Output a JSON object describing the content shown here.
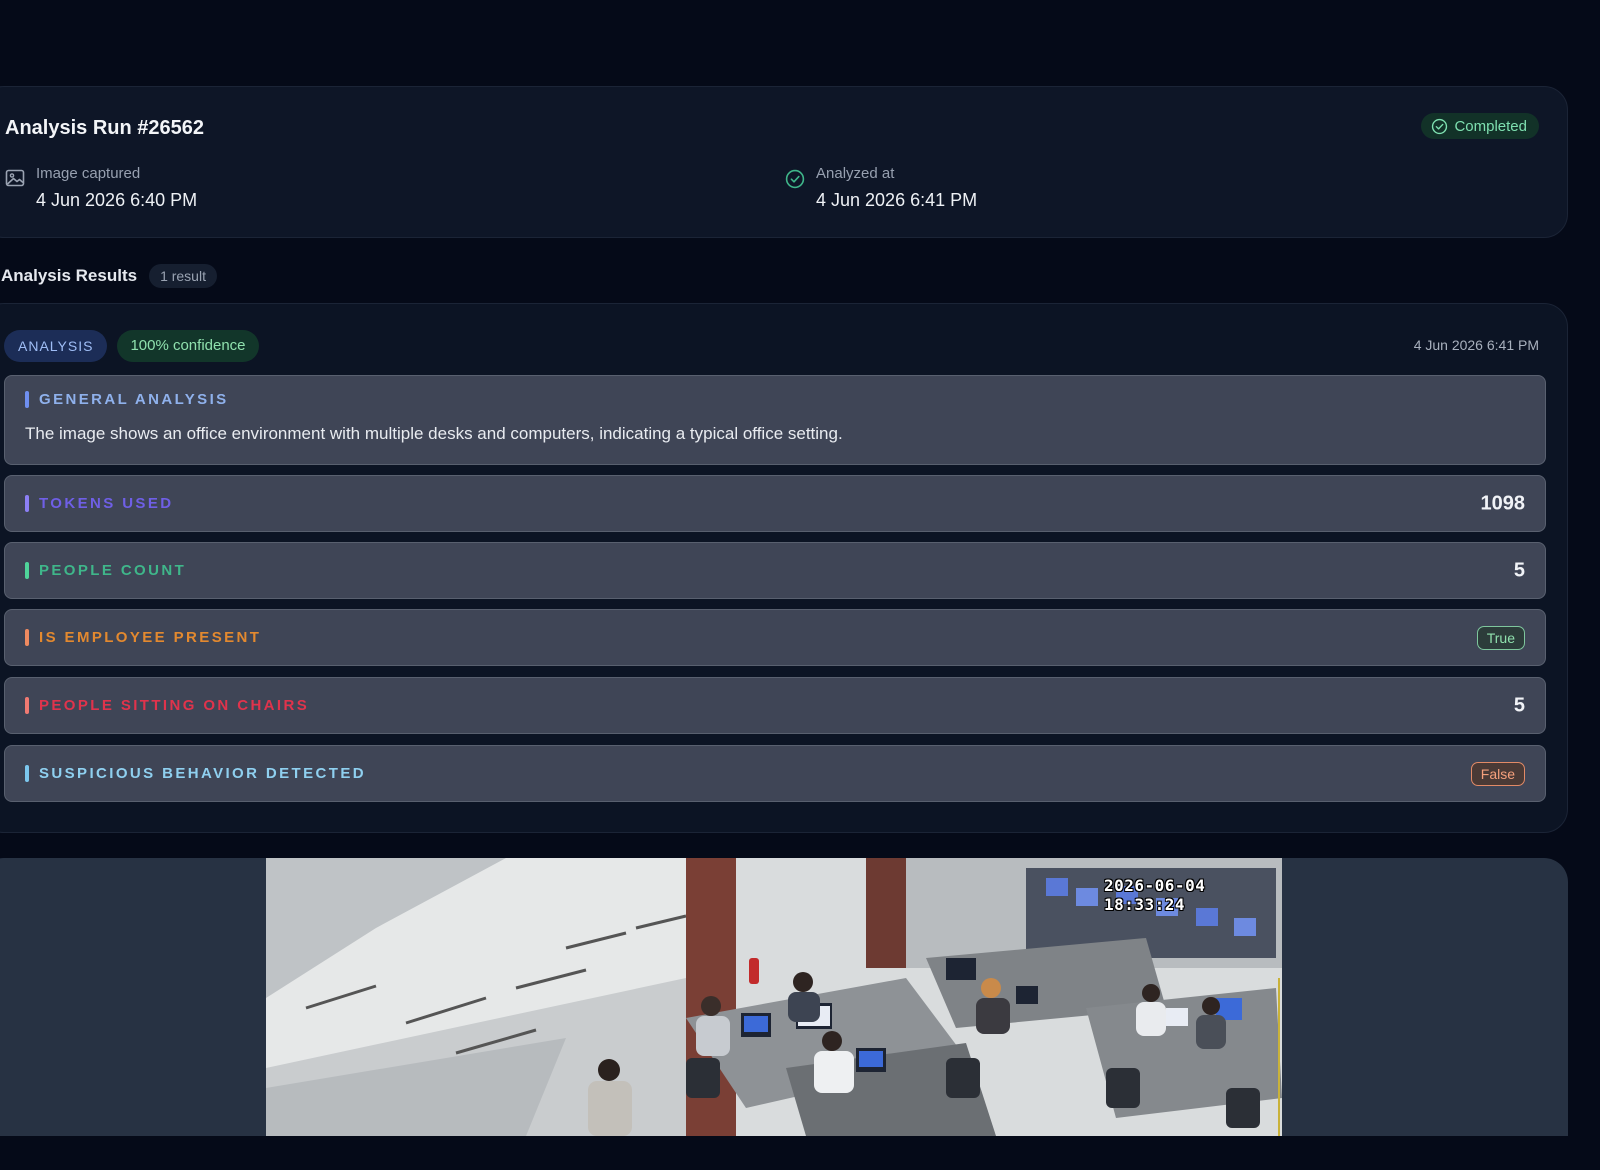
{
  "run": {
    "title": "Analysis Run #26562",
    "status": "Completed",
    "captured_label": "Image captured",
    "captured_value": "4 Jun 2026 6:40 PM",
    "analyzed_label": "Analyzed at",
    "analyzed_value": "4 Jun 2026 6:41 PM"
  },
  "results": {
    "title": "Analysis Results",
    "count": "1 result",
    "tag": "ANALYSIS",
    "confidence": "100% confidence",
    "timestamp": "4 Jun 2026 6:41 PM",
    "general": {
      "label": "GENERAL ANALYSIS",
      "text": "The image shows an office environment with multiple desks and computers, indicating a typical office setting."
    },
    "tokens": {
      "label": "TOKENS USED",
      "value": "1098"
    },
    "people_count": {
      "label": "PEOPLE COUNT",
      "value": "5"
    },
    "employee_present": {
      "label": "IS EMPLOYEE PRESENT",
      "value": "True"
    },
    "sitting": {
      "label": "PEOPLE SITTING ON CHAIRS",
      "value": "5"
    },
    "suspicious": {
      "label": "SUSPICIOUS BEHAVIOR DETECTED",
      "value": "False"
    }
  },
  "camera": {
    "timestamp": "2026-06-04 18:33:24"
  },
  "colors": {
    "background": "#050a18",
    "card": "#0e1627",
    "completed": "#7ee0b0",
    "tokens": "#6f5fe6",
    "people": "#3fb68a",
    "employee": "#e3892f",
    "sitting": "#e0334c",
    "suspicious": "#8fd0f0"
  },
  "icons": {
    "captured": "image-icon",
    "analyzed": "check-circle-icon",
    "status": "check-circle-icon"
  }
}
